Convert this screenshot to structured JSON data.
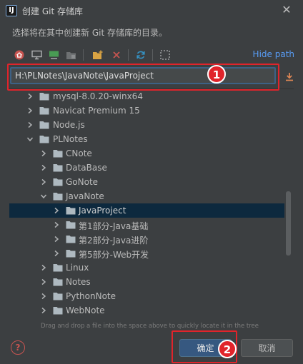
{
  "window": {
    "title": "创建 Git 存储库",
    "app_icon": "intellij-icon",
    "close_icon": "close-icon"
  },
  "instruction": "选择将在其中创建新 Git 存储库的目录。",
  "toolbar": {
    "icons": [
      "home-icon",
      "desktop-icon",
      "project-icon",
      "module-folder-icon",
      "new-folder-icon",
      "delete-icon",
      "refresh-icon",
      "show-hidden-icon"
    ],
    "hide_path": "Hide path"
  },
  "path_field": {
    "value": "H:\\PLNotes\\JavaNote\\JavaProject",
    "download_icon": "download-icon"
  },
  "annotations": {
    "one": "1",
    "two": "2"
  },
  "tree": {
    "rows": [
      {
        "label": "mysql-8.0.20-winx64",
        "expanded": false,
        "selected": false
      },
      {
        "label": "Navicat Premium 15",
        "expanded": false,
        "selected": false
      },
      {
        "label": "Node.js",
        "expanded": false,
        "selected": false
      },
      {
        "label": "PLNotes",
        "expanded": true,
        "selected": false
      },
      {
        "label": "CNote",
        "expanded": false,
        "selected": false
      },
      {
        "label": "DataBase",
        "expanded": false,
        "selected": false
      },
      {
        "label": "GoNote",
        "expanded": false,
        "selected": false
      },
      {
        "label": "JavaNote",
        "expanded": true,
        "selected": false
      },
      {
        "label": "JavaProject",
        "expanded": false,
        "selected": true
      },
      {
        "label": "第1部分-Java基础",
        "expanded": false,
        "selected": false
      },
      {
        "label": "第2部分-Java进阶",
        "expanded": false,
        "selected": false
      },
      {
        "label": "第5部分-Web开发",
        "expanded": false,
        "selected": false
      },
      {
        "label": "Linux",
        "expanded": false,
        "selected": false
      },
      {
        "label": "Notes",
        "expanded": false,
        "selected": false
      },
      {
        "label": "PythonNote",
        "expanded": false,
        "selected": false
      },
      {
        "label": "WebNote",
        "expanded": false,
        "selected": false
      }
    ]
  },
  "drag_hint": "Drag and drop a file into the space above to quickly locate it in the tree",
  "buttons": {
    "ok": "确定",
    "cancel": "取消",
    "help_icon": "help-icon"
  },
  "colors": {
    "background": "#3c3f41",
    "selection": "#0d293e",
    "link": "#589df6",
    "annotation": "#e0242b",
    "folder": "#aeb9c0"
  }
}
